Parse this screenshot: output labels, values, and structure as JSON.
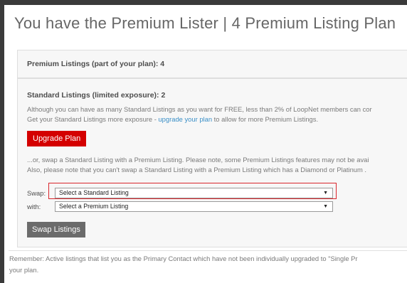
{
  "page": {
    "title": "You have the Premium Lister | 4 Premium Listing Plan"
  },
  "premium": {
    "label": "Premium Listings (part of your plan): 4"
  },
  "standard": {
    "label": "Standard Listings (limited exposure): 2",
    "para1": {
      "line1": "Although you can have as many Standard Listings as you want for FREE, less than 2% of LoopNet members can cor",
      "line2_before": "Get your Standard Listings more exposure - ",
      "line2_link": "upgrade your plan",
      "line2_after": " to allow for more Premium Listings."
    },
    "upgrade_button": "Upgrade Plan",
    "para2": {
      "line1": "...or, swap a Standard Listing with a Premium Listing. Please note, some Premium Listings features may not be avai",
      "line2": "Also, please note that you can't swap a Standard Listing with a Premium Listing which has a Diamond or Platinum ."
    },
    "swap_label": "Swap:",
    "swap_select": "Select a Standard Listing",
    "with_label": "with:",
    "with_select": "Select a Premium Listing",
    "swap_button": "Swap Listings"
  },
  "footer": {
    "line1": "Remember: Active listings that list you as the Primary Contact which have not been individually upgraded to \"Single Pr",
    "line2": "your plan."
  },
  "colors": {
    "accent_red": "#d40000",
    "link_blue": "#3a8fc7",
    "button_gray": "#6b6b6b",
    "highlight_red": "#d9262c"
  },
  "icons": {
    "dropdown": "chevron-down-icon"
  }
}
